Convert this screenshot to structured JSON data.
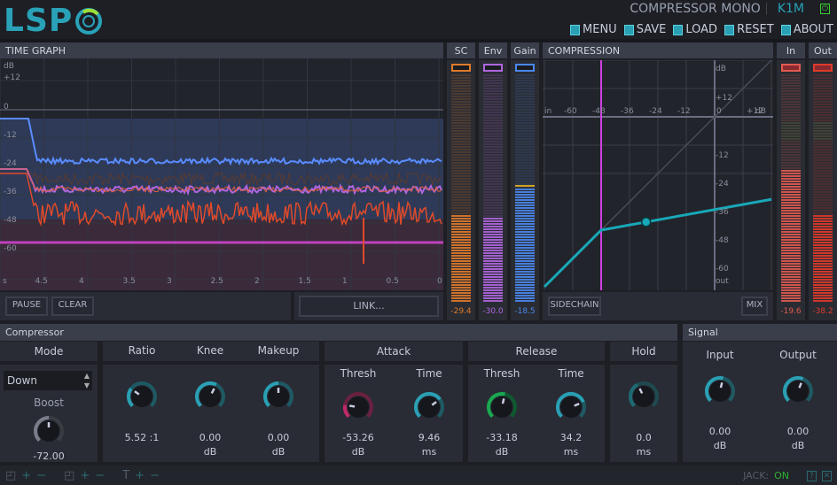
{
  "header": {
    "logo": "LSP",
    "plugin_name": "COMPRESSOR MONO",
    "preset": "K1M",
    "menu": [
      {
        "label": "MENU",
        "icon": "menu-icon"
      },
      {
        "label": "SAVE",
        "icon": "save-icon"
      },
      {
        "label": "LOAD",
        "icon": "load-icon"
      },
      {
        "label": "RESET",
        "icon": "reset-icon"
      },
      {
        "label": "ABOUT",
        "icon": "about-icon"
      }
    ]
  },
  "time_graph": {
    "title": "TIME GRAPH",
    "y_labels": [
      "dB",
      "+12",
      "0",
      "-12",
      "-24",
      "-36",
      "-48",
      "-60"
    ],
    "x_labels": [
      "s",
      "4.5",
      "4",
      "3.5",
      "3",
      "2.5",
      "2",
      "1.5",
      "1",
      "0.5",
      "0"
    ],
    "pause": "PAUSE",
    "clear": "CLEAR",
    "link": "LINK..."
  },
  "meters": {
    "sc": {
      "label": "SC",
      "value": "-29.4",
      "color": "#e07a2a",
      "level": 0.38
    },
    "env": {
      "label": "Env",
      "value": "-30.0",
      "color": "#b066e0",
      "level": 0.37
    },
    "gain": {
      "label": "Gain",
      "value": "-18.5",
      "color": "#4a88ee",
      "level": 0.5
    },
    "in": {
      "label": "In",
      "value": "-19.6",
      "color": "#e05a50",
      "level": 0.58
    },
    "out": {
      "label": "Out",
      "value": "-38.2",
      "color": "#e03a2a",
      "level": 0.38
    }
  },
  "compression": {
    "title": "COMPRESSION",
    "in_labels": [
      "in",
      "-60",
      "-48",
      "-36",
      "-24",
      "-12",
      "0",
      "+12",
      "dB"
    ],
    "out_labels": [
      "dB",
      "+12",
      "-12",
      "-24",
      "-36",
      "-48",
      "-60",
      "out"
    ],
    "sidechain": "SIDECHAIN",
    "mix": "MIX",
    "threshold_db": -48,
    "ratio": 5.52
  },
  "compressor": {
    "title": "Compressor",
    "mode_label": "Mode",
    "mode_value": "Down",
    "boost_label": "Boost",
    "boost_value": "-72.00",
    "ratio": {
      "label": "Ratio",
      "value": "5.52 :1",
      "level": 0.3
    },
    "knee": {
      "label": "Knee",
      "value": "0.00",
      "unit": "dB",
      "level": 0.6
    },
    "makeup": {
      "label": "Makeup",
      "value": "0.00",
      "unit": "dB",
      "level": 0.5
    },
    "attack": {
      "label": "Attack",
      "thresh_label": "Thresh",
      "thresh_value": "-53.26",
      "thresh_unit": "dB",
      "thresh_level": 0.2,
      "time_label": "Time",
      "time_value": "9.46",
      "time_unit": "ms",
      "time_level": 0.7
    },
    "release": {
      "label": "Release",
      "thresh_label": "Thresh",
      "thresh_value": "-33.18",
      "thresh_unit": "dB",
      "thresh_level": 0.55,
      "time_label": "Time",
      "time_value": "34.2",
      "time_unit": "ms",
      "time_level": 0.75
    },
    "hold": {
      "label": "Hold",
      "value": "0.0",
      "unit": "ms",
      "level": 0.4
    }
  },
  "signal": {
    "title": "Signal",
    "input": {
      "label": "Input",
      "value": "0.00",
      "unit": "dB",
      "level": 0.55
    },
    "output": {
      "label": "Output",
      "value": "0.00",
      "unit": "dB",
      "level": 0.58
    }
  },
  "footer": {
    "jack_label": "JACK:",
    "jack_status": "ON"
  }
}
